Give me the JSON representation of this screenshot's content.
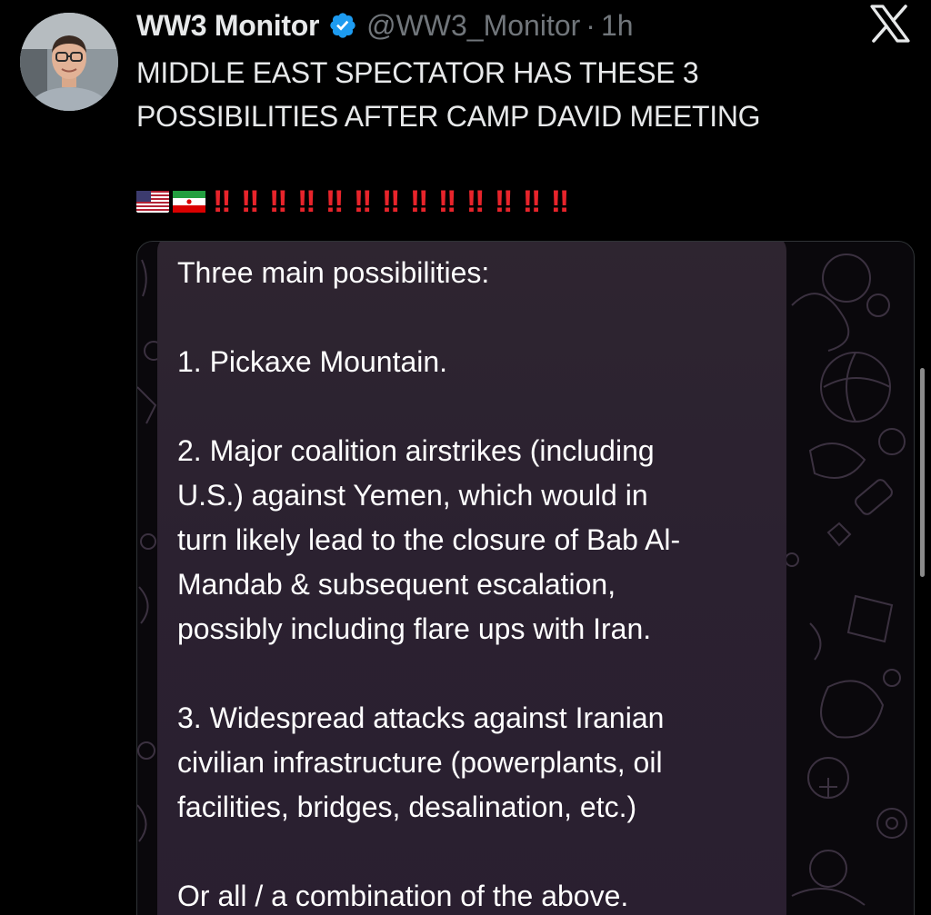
{
  "tweet": {
    "author": {
      "display_name": "WW3 Monitor",
      "handle": "@WW3_Monitor",
      "verified": true,
      "avatar_icon": "profile-photo"
    },
    "separator": "·",
    "time": "1h",
    "text_lines": [
      "MIDDLE EAST SPECTATOR HAS THESE 3",
      "POSSIBILITIES AFTER CAMP DAVID MEETING"
    ],
    "emoji": {
      "flags": [
        "flag-united-states",
        "flag-iran"
      ],
      "exclamations": "‼ ‼ ‼ ‼ ‼ ‼ ‼ ‼ ‼ ‼ ‼ ‼ ‼"
    }
  },
  "media": {
    "message_lines": [
      "Three main possibilities:",
      "",
      "1. Pickaxe Mountain.",
      "",
      "2. Major coalition airstrikes (including",
      "U.S.) against Yemen, which would in",
      "turn likely lead to the closure of Bab Al-",
      "Mandab & subsequent escalation,",
      "possibly including flare ups with Iran.",
      "",
      "3. Widespread attacks against Iranian",
      "civilian infrastructure (powerplants, oil",
      "facilities, bridges, desalination, etc.)",
      "",
      "Or all / a combination of the above."
    ]
  },
  "icons": {
    "close": "x-logo-icon",
    "verified": "verified-badge-icon"
  },
  "colors": {
    "background": "#000000",
    "text_primary": "#e7e9ea",
    "text_secondary": "#71767b",
    "verified_blue": "#1d9bf0",
    "exclamation_red": "#e8242b",
    "bubble": "#2b2130"
  }
}
